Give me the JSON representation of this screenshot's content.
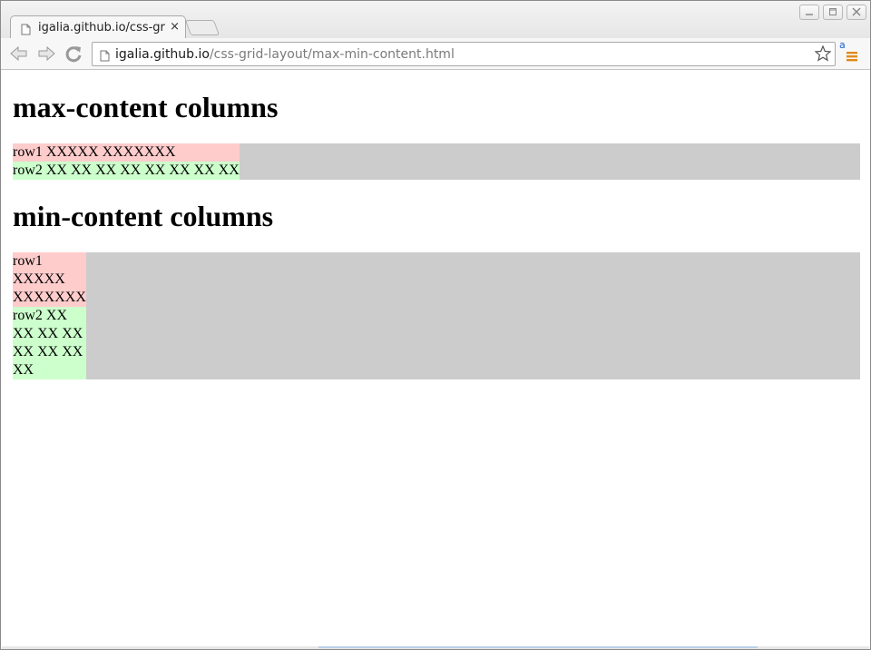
{
  "browser": {
    "tab": {
      "title": "igalia.github.io/css-grid-layout/max-min-content.html",
      "close_label": "×"
    },
    "address": {
      "host": "igalia.github.io",
      "path": "/css-grid-layout/max-min-content.html"
    },
    "extension_letter": "a",
    "icons": [
      "page-icon",
      "back-icon",
      "forward-icon",
      "reload-icon",
      "star-icon",
      "menu-icon",
      "minimize-icon",
      "maximize-icon",
      "close-icon"
    ]
  },
  "page": {
    "sections": [
      {
        "heading": "max-content columns",
        "rows": [
          {
            "text": "row1 XXXXX XXXXXXX",
            "color": "#ffcccc"
          },
          {
            "text": "row2 XX XX XX XX XX XX XX XX",
            "color": "#ccffcc"
          }
        ]
      },
      {
        "heading": "min-content columns",
        "rows": [
          {
            "text": "row1 XXXXX XXXXXXX",
            "color": "#ffcccc"
          },
          {
            "text": "row2 XX XX XX XX XX XX XX XX",
            "color": "#ccffcc"
          }
        ]
      }
    ],
    "grid_background": "#cccccc"
  }
}
